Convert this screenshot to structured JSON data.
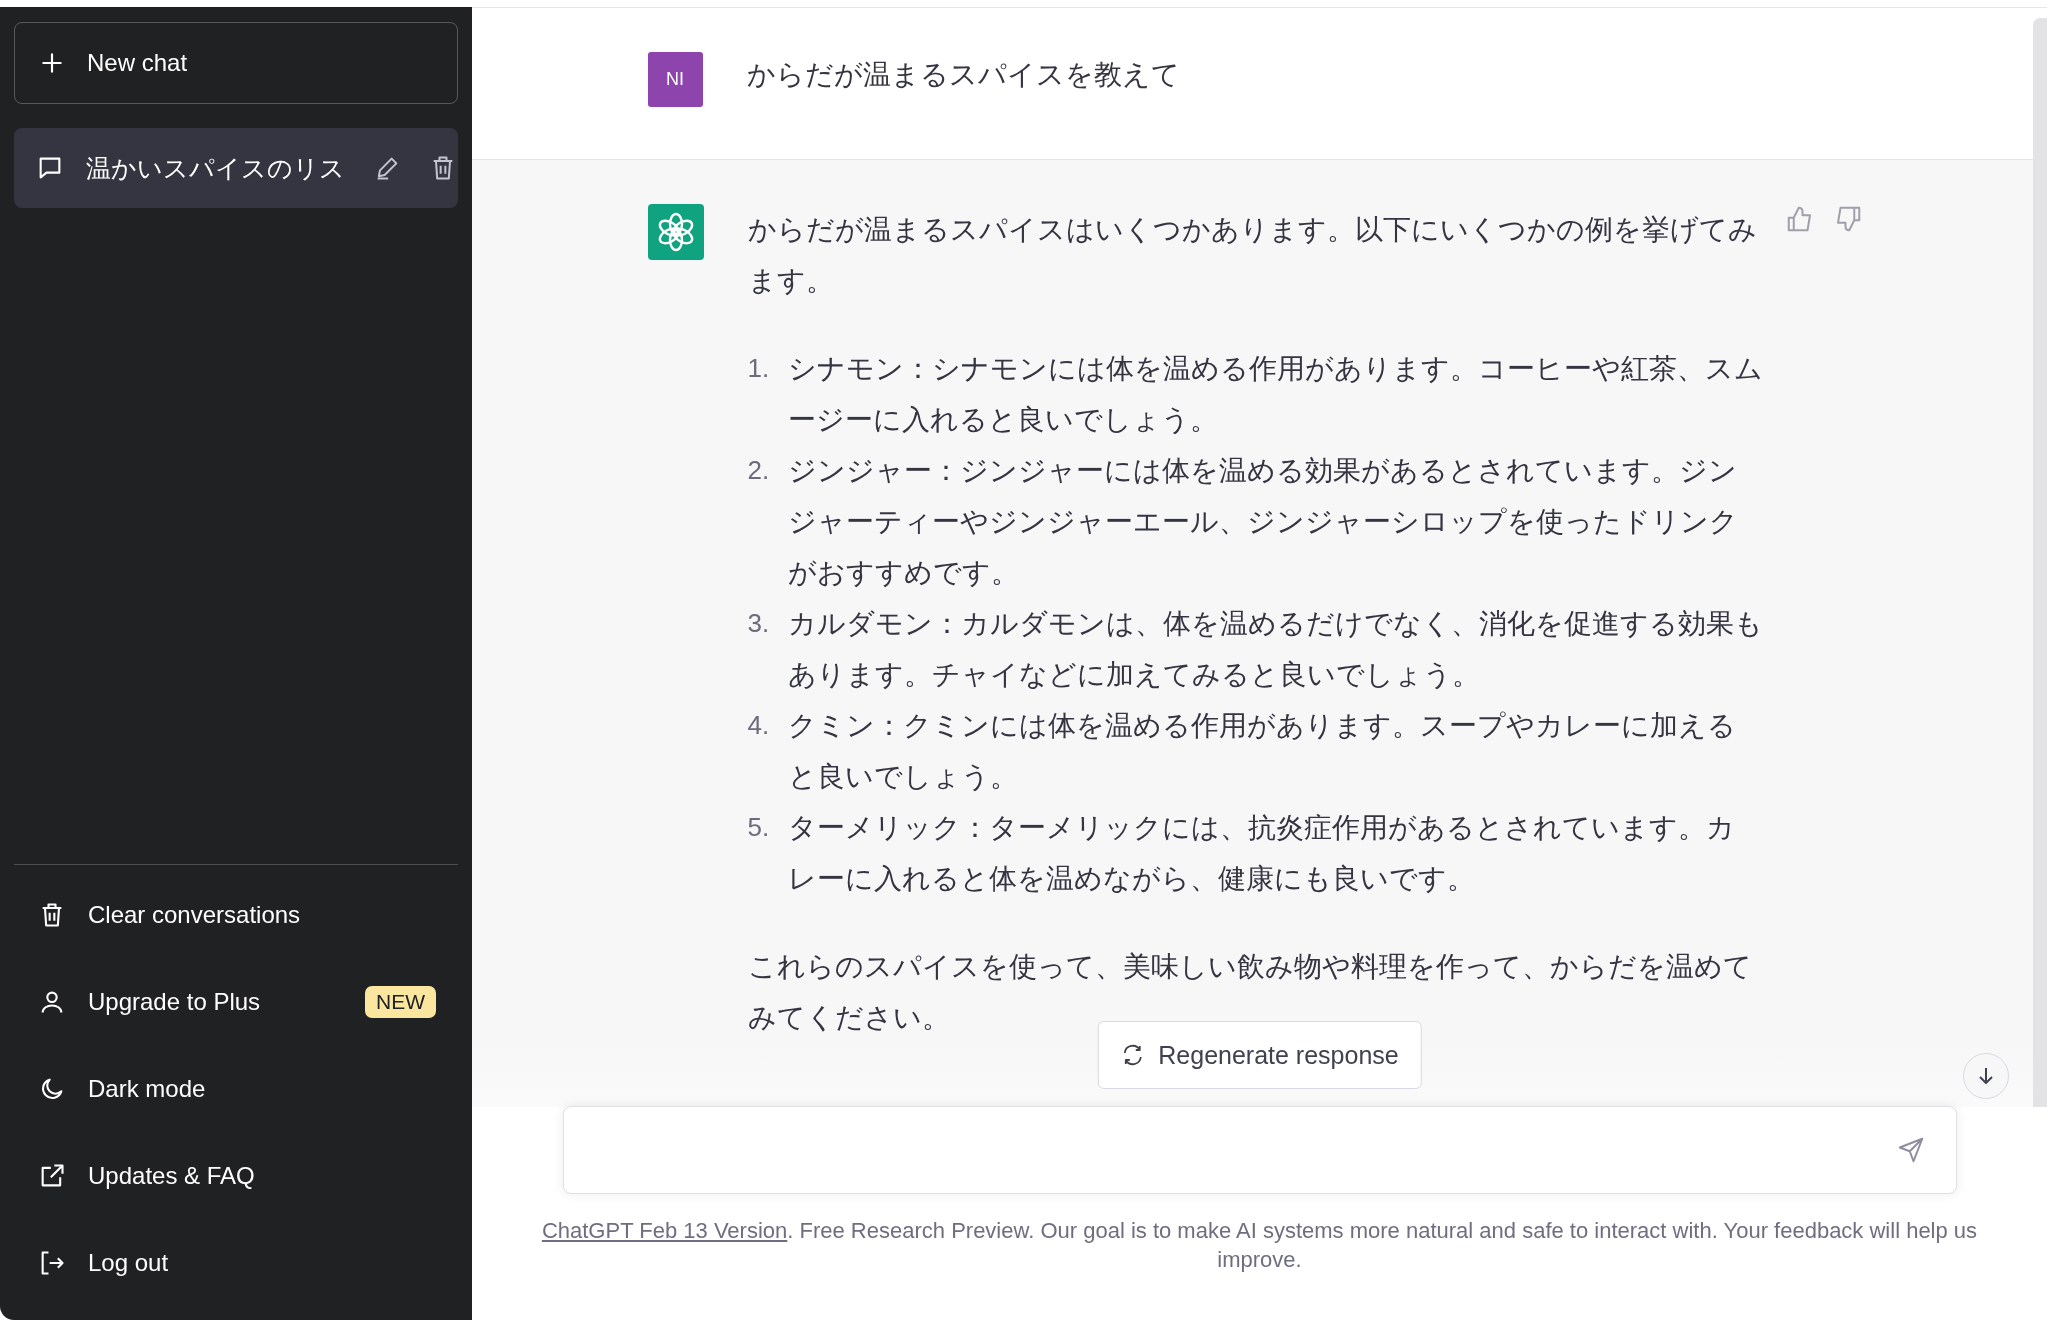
{
  "sidebar": {
    "new_chat": "New chat",
    "conversations": [
      {
        "title": "温かいスパイスのリス",
        "selected": true
      }
    ],
    "menu": [
      {
        "kind": "clear",
        "label": "Clear conversations"
      },
      {
        "kind": "upgrade",
        "label": "Upgrade to Plus",
        "badge": "NEW"
      },
      {
        "kind": "dark",
        "label": "Dark mode"
      },
      {
        "kind": "external",
        "label": "Updates & FAQ"
      },
      {
        "kind": "logout",
        "label": "Log out"
      }
    ]
  },
  "messages": [
    {
      "kind": "user",
      "avatar": "NI",
      "text": "からだが温まるスパイスを教えて"
    },
    {
      "kind": "assistant",
      "intro": "からだが温まるスパイスはいくつかあります。以下にいくつかの例を挙げてみます。",
      "list": [
        {
          "number": "1.",
          "text": "シナモン：シナモンには体を温める作用があります。コーヒーや紅茶、スムージーに入れると良いでしょう。"
        },
        {
          "number": "2.",
          "text": "ジンジャー：ジンジャーには体を温める効果があるとされています。ジンジャーティーやジンジャーエール、ジンジャーシロップを使ったドリンクがおすすめです。"
        },
        {
          "number": "3.",
          "text": "カルダモン：カルダモンは、体を温めるだけでなく、消化を促進する効果もあります。チャイなどに加えてみると良いでしょう。"
        },
        {
          "number": "4.",
          "text": "クミン：クミンには体を温める作用があります。スープやカレーに加えると良いでしょう。"
        },
        {
          "number": "5.",
          "text": "ターメリック：ターメリックには、抗炎症作用があるとされています。カレーに入れると体を温めながら、健康にも良いです。"
        }
      ],
      "outro": "これらのスパイスを使って、美味しい飲み物や料理を作って、からだを温めてみてください。"
    }
  ],
  "regenerate_button": "Regenerate response",
  "footer": {
    "link": "ChatGPT Feb 13 Version",
    "text": ". Free Research Preview. Our goal is to make AI systems more natural and safe to interact with. Your feedback will help us improve."
  }
}
